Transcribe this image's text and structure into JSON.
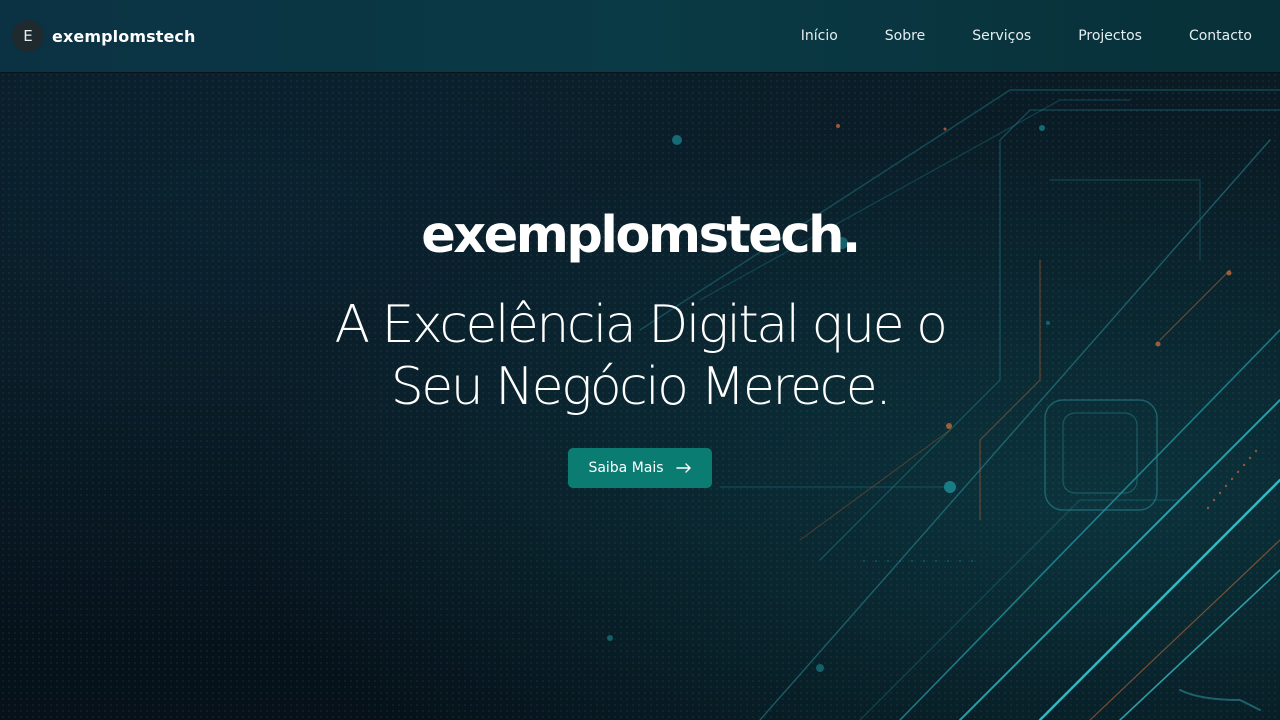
{
  "header": {
    "logo_letter": "E",
    "brand_name": "exemplomstech",
    "nav": [
      {
        "label": "Início"
      },
      {
        "label": "Sobre"
      },
      {
        "label": "Serviços"
      },
      {
        "label": "Projectos"
      },
      {
        "label": "Contacto"
      }
    ]
  },
  "hero": {
    "brand": "exemplomstech.",
    "headline_line1": "A Excelência Digital que o",
    "headline_line2": "Seu Negócio Merece.",
    "cta_label": "Saiba Mais",
    "cta_icon": "arrow-right-icon"
  },
  "colors": {
    "header_bg": "#0a3a45",
    "accent": "#0b7c72",
    "background": "#06131c"
  }
}
